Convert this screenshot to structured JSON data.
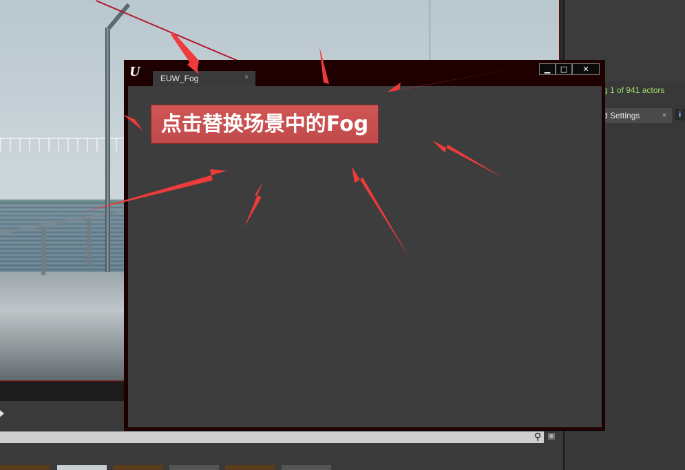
{
  "right_panel": {
    "actor_count_text": "g 1 of 941 actors",
    "settings_tab_label": "d Settings",
    "settings_tab_close": "×",
    "info_icon_glyph": "i"
  },
  "window": {
    "logo_glyph": "U",
    "tab_label": "EUW_Fog",
    "tab_close": "×",
    "controls": {
      "minimize": "▁",
      "maximize": "□",
      "close": "✕"
    }
  },
  "content": {
    "fog_button_label": "点击替换场景中的Fog"
  },
  "bottom": {
    "search_icon_glyph": "⚲",
    "save_icon_glyph": "▣"
  },
  "colors": {
    "accent_button": "#c94f4f",
    "window_frame": "#1a0000",
    "annotation_arrow": "#ee3b3b",
    "actor_count_text": "#9bd96a"
  }
}
